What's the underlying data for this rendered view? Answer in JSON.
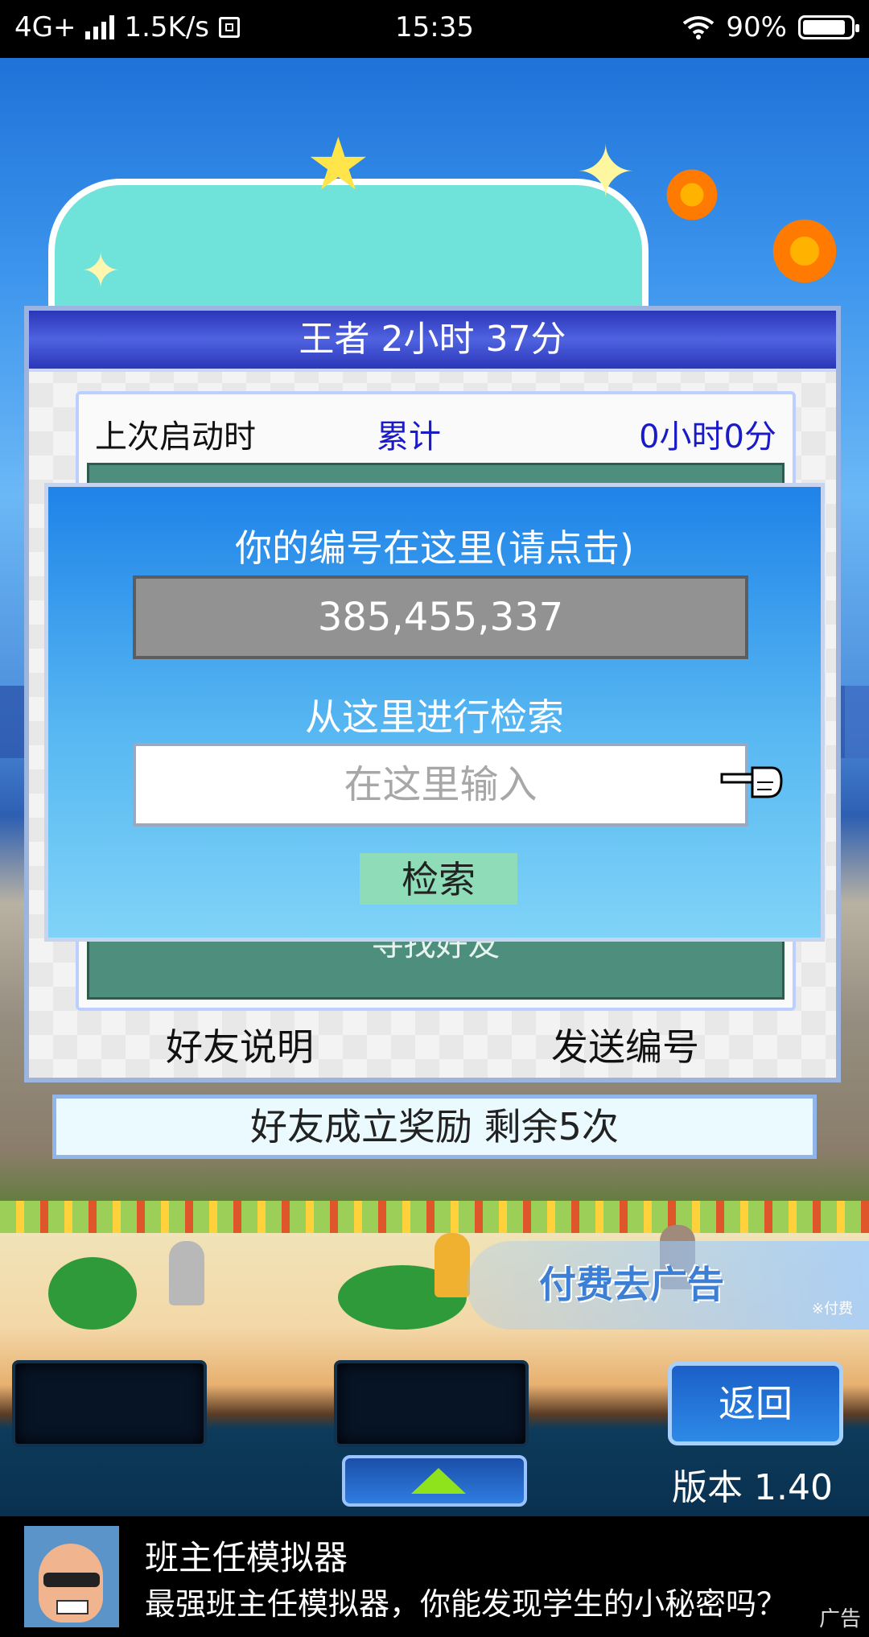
{
  "status_bar": {
    "network": "4G+",
    "speed": "1.5K/s",
    "time": "15:35",
    "battery": "90%",
    "battery_level": 0.9
  },
  "panel": {
    "title": "王者  2小时 37分",
    "last_launch_label": "上次启动时",
    "total_label": "累计",
    "total_value": "0小时0分",
    "find_friend_label": "寻找好友",
    "friend_help": "好友说明",
    "send_id": "发送编号"
  },
  "dialog": {
    "heading": "你的编号在这里(请点击)",
    "player_id": "385,455,337",
    "search_heading": "从这里进行检索",
    "search_placeholder": "在这里输入",
    "search_button": "检索"
  },
  "reward_bar": "好友成立奖励  剩余5次",
  "promo_banner": {
    "text": "付费去广告",
    "note": "※付费"
  },
  "controls": {
    "back": "返回",
    "version": "版本 1.40"
  },
  "ad": {
    "title": "班主任模拟器",
    "description": "最强班主任模拟器，你能发现学生的小秘密吗？",
    "tag": "广告"
  }
}
